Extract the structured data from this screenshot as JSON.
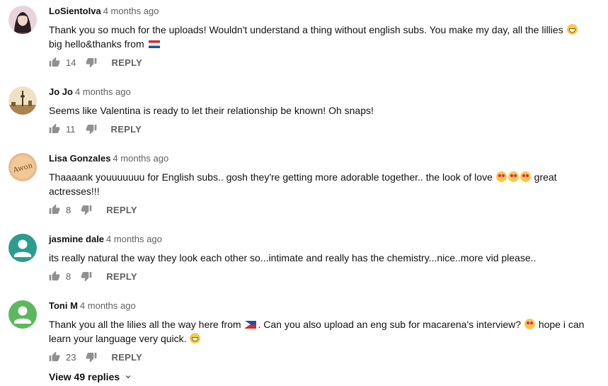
{
  "comments": [
    {
      "author": "LoSientoIva",
      "time": "4 months ago",
      "text_1": "Thank you so much for the uploads! Wouldn't understand a thing without english subs. You make my day, all the lillies",
      "text_2": "big hello&thanks from",
      "likes": "14",
      "reply_label": "REPLY"
    },
    {
      "author": "Jo Jo",
      "time": "4 months ago",
      "text_1": "Seems like Valentina is ready to let their relationship be known! Oh snaps!",
      "likes": "11",
      "reply_label": "REPLY"
    },
    {
      "author": "Lisa Gonzales",
      "time": "4 months ago",
      "text_1": "Thaaaank youuuuuuu for English subs.. gosh they're getting more adorable together.. the look of love",
      "text_2": "great actresses!!!",
      "likes": "8",
      "reply_label": "REPLY"
    },
    {
      "author": "jasmine dale",
      "time": "4 months ago",
      "text_1": "its really natural the way they look each other so...intimate and really has the chemistry...nice..more vid please..",
      "likes": "8",
      "reply_label": "REPLY"
    },
    {
      "author": "Toni M",
      "time": "4 months ago",
      "text_1": "Thank you all the lilies all the way here from",
      "text_2": ". Can you also upload an eng sub for macarena's interview?",
      "text_3": "hope i can learn your language very quick.",
      "likes": "23",
      "reply_label": "REPLY"
    }
  ],
  "view_replies_label": "View 49 replies",
  "avatar_text_lisa": "Awon",
  "colors": {
    "teal_avatar": "#2a9d8f",
    "green_avatar": "#5cb85c",
    "emoji": "#f7c948",
    "meta_gray": "#606060"
  }
}
